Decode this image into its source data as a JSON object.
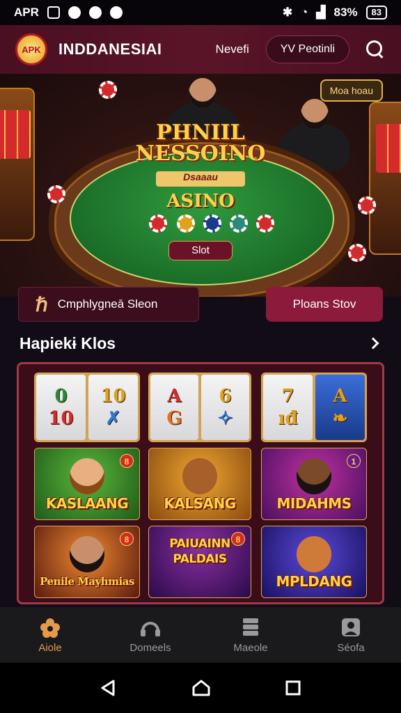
{
  "status_bar": {
    "carrier": "APR",
    "battery_percent": "83%",
    "battery_label": "83"
  },
  "app_bar": {
    "logo_text": "APK",
    "title": "INDDANESIAI",
    "nav_link": "Nevefi",
    "nav_pill": "YV Peotinli"
  },
  "hero": {
    "title_line1": "PHNIIL",
    "title_line2": "NESSOINO",
    "subtitle": "Dsaaau",
    "casino": "ASINO",
    "slot_button": "Slot",
    "promo_badge": "Moa hoau"
  },
  "cta": {
    "left_label": "Cmphlyɡneā Sleon",
    "right_label": "Ploans Stov"
  },
  "section": {
    "title": "Hapiekɨ Klos"
  },
  "reels": [
    {
      "symbols": [
        [
          "0",
          "#2a8a3a"
        ],
        [
          "10",
          "#d32b2b"
        ]
      ]
    },
    {
      "symbols": [
        [
          "10",
          "#e0a21c"
        ],
        [
          "✗",
          "#2a7ad8"
        ]
      ]
    },
    {
      "symbols": [
        [
          "A",
          "#d32b2b"
        ],
        [
          "G",
          "#e0731c"
        ]
      ]
    },
    {
      "symbols": [
        [
          "6",
          "#e0a21c"
        ],
        [
          "✧",
          "#2a7ad8"
        ]
      ]
    },
    {
      "symbols": [
        [
          "7",
          "#e0a21c"
        ],
        [
          "ıđ",
          "#e0a21c"
        ]
      ]
    },
    {
      "symbols": [
        [
          "A",
          "#e0a21c"
        ],
        [
          "❧",
          "#e0a21c"
        ]
      ]
    }
  ],
  "games": [
    {
      "name": "KASLAANG",
      "badge": "8"
    },
    {
      "name": "KALSANG",
      "badge": ""
    },
    {
      "name": "MIDAHMS",
      "badge": "1"
    },
    {
      "name": "Penile Mayhmias",
      "badge": "8"
    },
    {
      "name": "PAIUAINN PALDAIS",
      "badge": "8"
    },
    {
      "name": "MPLDANG",
      "badge": ""
    }
  ],
  "bottom_nav": [
    {
      "label": "Aiole",
      "icon": "flower-icon"
    },
    {
      "label": "Domeels",
      "icon": "headset-icon"
    },
    {
      "label": "Maeole",
      "icon": "database-icon"
    },
    {
      "label": "Séofa",
      "icon": "user-card-icon"
    }
  ],
  "colors": {
    "accent_primary": "#8c1a3a",
    "accent_gold": "#ffd24a",
    "active_nav": "#e39a4a"
  }
}
